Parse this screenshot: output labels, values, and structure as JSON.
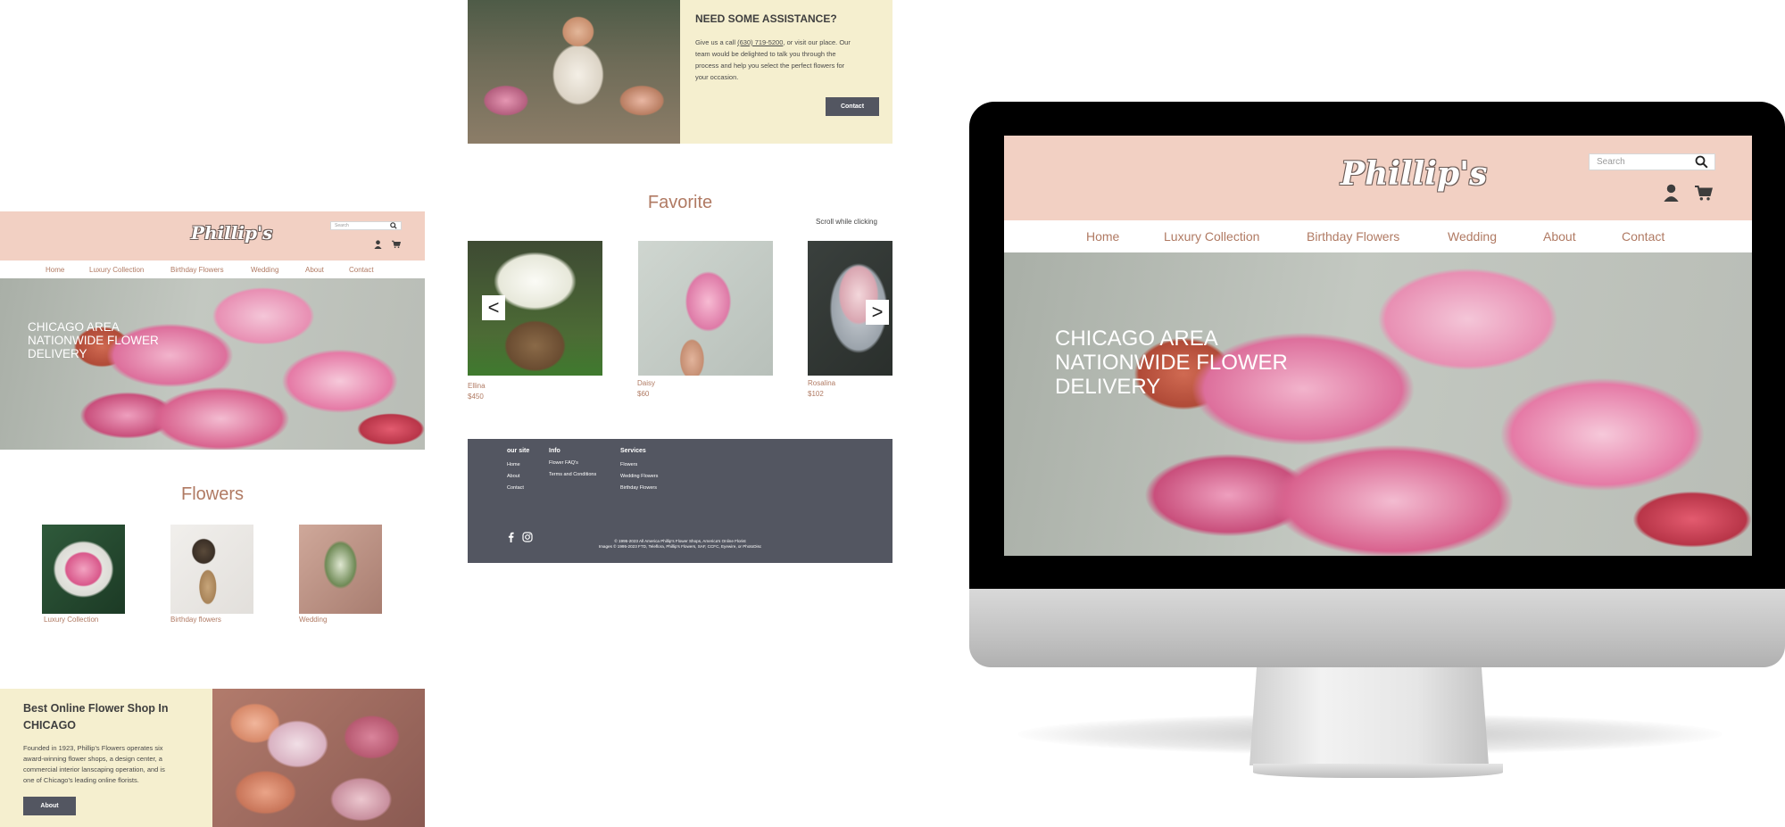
{
  "brand": {
    "logo_text": "Phillip's"
  },
  "nav": [
    "Home",
    "Luxury Collection",
    "Birthday Flowers",
    "Wedding",
    "About",
    "Contact"
  ],
  "search": {
    "placeholder": "Search"
  },
  "hero": {
    "lines": [
      "CHICAGO AREA",
      "NATIONWIDE FLOWER",
      "DELIVERY"
    ]
  },
  "flowers_section": {
    "title": "Flowers",
    "categories": [
      "Luxury Collection",
      "Birthday flowers",
      "Wedding"
    ]
  },
  "best_shop": {
    "title_line1": "Best Online Flower Shop In",
    "title_line2": "CHICAGO",
    "body_lines": [
      "Founded in 1923, Phillip's Flowers operates six",
      "award-winning flower shops, a design center, a",
      "commercial interior lanscaping operation, and is",
      "one of Chicago's leading online florists."
    ],
    "button": "About"
  },
  "assistance": {
    "title": "NEED SOME ASSISTANCE?",
    "line1_pre": "Give us a call ",
    "phone": "(630) 719-5200",
    "line1_post": ", or visit our place. Our",
    "line2": "team would be delighted to talk you through the",
    "line3": "process and help you select the perfect flowers for",
    "line4": "your occasion.",
    "button": "Contact"
  },
  "favorite": {
    "title": "Favorite",
    "hint": "Scroll while clicking",
    "prev": "<",
    "next": ">",
    "items": [
      {
        "name": "Ellina",
        "price": "$450"
      },
      {
        "name": "Daisy",
        "price": "$60"
      },
      {
        "name": "Rosalina",
        "price": "$102"
      }
    ]
  },
  "footer": {
    "col1": {
      "head": "our site",
      "links": [
        "Home",
        "About",
        "Contact"
      ]
    },
    "col2": {
      "head": "Info",
      "links": [
        "Flower FAQ's",
        "Terms and Conditions"
      ]
    },
    "col3": {
      "head": "Services",
      "links": [
        "Flowers",
        "Wedding Flowers",
        "Birthday Flowers"
      ]
    },
    "legal_line1": "© 1995-2023 All America Phillip's Flower Shops, America's Online Florist",
    "legal_line2": "Images © 1995-2023 FTD, Teleflora, Phillip's Flowers, SAF, CCFC, Eyewire, or PhotoDisc"
  },
  "colors": {
    "header_pink": "#f2d0c3",
    "accent_brown": "#b07a63",
    "cream": "#f5efcf",
    "button_dark": "#535661",
    "footer_bg": "#535661"
  }
}
